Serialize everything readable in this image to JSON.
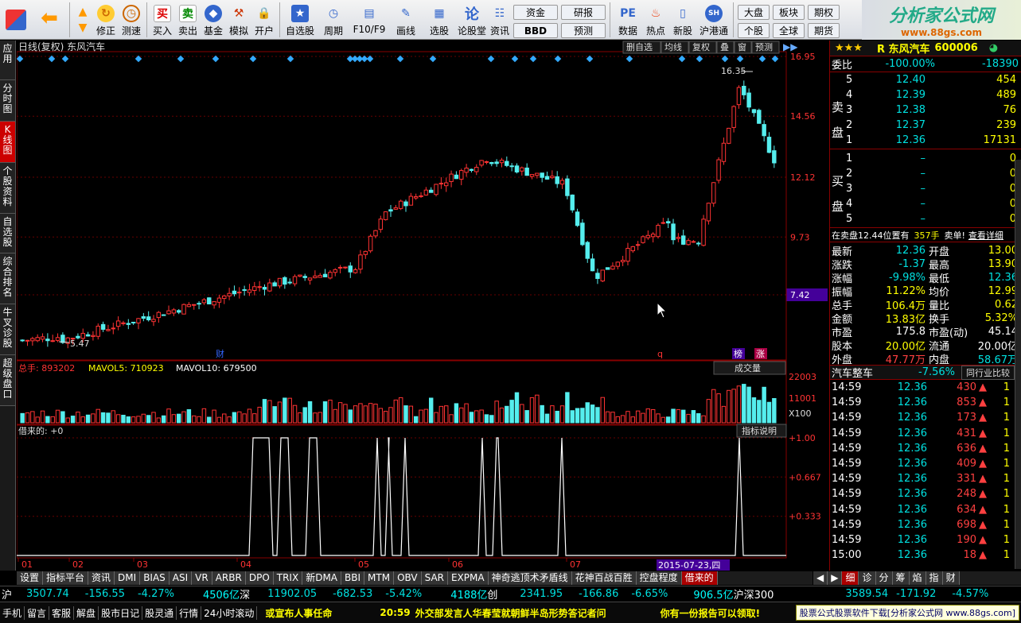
{
  "toolbar": {
    "buttons": [
      "修正",
      "测速",
      "买入",
      "卖出",
      "基金",
      "模拟",
      "开户",
      "自选股",
      "周期",
      "F10/F9",
      "画线",
      "选股",
      "论股堂",
      "资讯",
      "数据",
      "热点",
      "新股",
      "沪港通"
    ],
    "small": [
      "资金",
      "研报",
      "BBD",
      "预测",
      "大盘",
      "板块",
      "期权",
      "个股",
      "全球",
      "期货"
    ]
  },
  "logo": {
    "title": "分析家公式网",
    "url": "www.88gs.com"
  },
  "left_tabs": [
    "应用",
    "分时图",
    "K线图",
    "个股资料",
    "自选股",
    "综合排名",
    "牛叉诊股",
    "超级盘口"
  ],
  "chart_header": {
    "title": "日线(复权) 东风汽车",
    "tabs": [
      "删自选",
      "均线",
      "复权",
      "叠",
      "窗",
      "预测"
    ]
  },
  "price_axis": [
    "16.95",
    "14.56",
    "12.12",
    "9.73",
    "7.42"
  ],
  "annotations": {
    "high": "16.35",
    "low": "5.47",
    "marks": [
      "财",
      "q",
      "榜",
      "涨"
    ]
  },
  "volume_header": {
    "label": "总手: 893202",
    "ma5": "MAVOL5: 710923",
    "ma10": "MAVOL10: 679500",
    "selector": "成交量"
  },
  "volume_axis": [
    "22003",
    "11001",
    "X100"
  ],
  "indicator_header": {
    "label": "借来的: +0",
    "explain": "指标说明"
  },
  "indicator_axis": [
    "+1.00",
    "+0.667",
    "+0.333"
  ],
  "time_axis": [
    "01",
    "02",
    "03",
    "04",
    "05",
    "06",
    "07",
    "2015-07-23,四"
  ],
  "bottom_tabs": [
    "设置",
    "指标平台",
    "资讯",
    "DMI",
    "BIAS",
    "ASI",
    "VR",
    "ARBR",
    "DPO",
    "TRIX",
    "新DMA",
    "BBI",
    "MTM",
    "OBV",
    "SAR",
    "EXPMA",
    "神奇逃顶术矛盾线",
    "花神百战百胜",
    "控盘程度",
    "借来的"
  ],
  "right_bottom_tabs": [
    "细",
    "诊",
    "分",
    "筹",
    "焰",
    "指",
    "财"
  ],
  "stock": {
    "name": "R 东风汽车",
    "code": "600006",
    "weibi_label": "委比",
    "weibi": "-100.00%",
    "weicha": "-18390"
  },
  "sell_levels": [
    {
      "n": "5",
      "price": "12.40",
      "vol": "454"
    },
    {
      "n": "4",
      "price": "12.39",
      "vol": "489"
    },
    {
      "n": "3",
      "price": "12.38",
      "vol": "76"
    },
    {
      "n": "2",
      "price": "12.37",
      "vol": "239"
    },
    {
      "n": "1",
      "price": "12.36",
      "vol": "17131"
    }
  ],
  "buy_levels": [
    {
      "n": "1",
      "price": "–",
      "vol": "0"
    },
    {
      "n": "2",
      "price": "–",
      "vol": "0"
    },
    {
      "n": "3",
      "price": "–",
      "vol": "0"
    },
    {
      "n": "4",
      "price": "–",
      "vol": "0"
    },
    {
      "n": "5",
      "price": "–",
      "vol": "0"
    }
  ],
  "sell_label": "卖盘",
  "buy_label": "买盘",
  "pending": {
    "text": "在卖盘12.44位置有",
    "vol": "357手",
    "sell": "卖单!",
    "detail": "查看详细"
  },
  "quote": [
    {
      "k1": "最新",
      "v1": "12.36",
      "k2": "开盘",
      "v2": "13.00"
    },
    {
      "k1": "涨跌",
      "v1": "-1.37",
      "k2": "最高",
      "v2": "13.90"
    },
    {
      "k1": "涨幅",
      "v1": "-9.98%",
      "k2": "最低",
      "v2": "12.36"
    },
    {
      "k1": "振幅",
      "v1": "11.22%",
      "k2": "均价",
      "v2": "12.99"
    },
    {
      "k1": "总手",
      "v1": "106.4万",
      "k2": "量比",
      "v2": "0.62"
    },
    {
      "k1": "金额",
      "v1": "13.83亿",
      "k2": "换手",
      "v2": "5.32%"
    },
    {
      "k1": "市盈",
      "v1": "175.8",
      "k2": "市盈(动)",
      "v2": "45.14"
    },
    {
      "k1": "股本",
      "v1": "20.00亿",
      "k2": "流通",
      "v2": "20.00亿"
    },
    {
      "k1": "外盘",
      "v1": "47.77万",
      "k2": "内盘",
      "v2": "58.67万"
    }
  ],
  "industry": {
    "name": "汽车整车",
    "change": "-7.56%",
    "compare": "同行业比较"
  },
  "ticks": [
    {
      "t": "14:59",
      "p": "12.36",
      "v": "430",
      "n": "1"
    },
    {
      "t": "14:59",
      "p": "12.36",
      "v": "853",
      "n": "1"
    },
    {
      "t": "14:59",
      "p": "12.36",
      "v": "173",
      "n": "1"
    },
    {
      "t": "14:59",
      "p": "12.36",
      "v": "431",
      "n": "1"
    },
    {
      "t": "14:59",
      "p": "12.36",
      "v": "636",
      "n": "1"
    },
    {
      "t": "14:59",
      "p": "12.36",
      "v": "409",
      "n": "1"
    },
    {
      "t": "14:59",
      "p": "12.36",
      "v": "331",
      "n": "1"
    },
    {
      "t": "14:59",
      "p": "12.36",
      "v": "248",
      "n": "1"
    },
    {
      "t": "14:59",
      "p": "12.36",
      "v": "634",
      "n": "1"
    },
    {
      "t": "14:59",
      "p": "12.36",
      "v": "698",
      "n": "1"
    },
    {
      "t": "14:59",
      "p": "12.36",
      "v": "190",
      "n": "1"
    },
    {
      "t": "15:00",
      "p": "12.36",
      "v": "18",
      "n": "1"
    }
  ],
  "status1": {
    "sh": "沪",
    "sh_val": "3507.74",
    "sh_chg": "-156.55",
    "sh_pct": "-4.27%",
    "sh_amt": "4506亿",
    "sz": "深",
    "sz_val": "11902.05",
    "sz_chg": "-682.53",
    "sz_pct": "-5.42%",
    "sz_amt": "4188亿",
    "cy": "创",
    "cy_val": "2341.95",
    "cy_chg": "-166.86",
    "cy_pct": "-6.65%",
    "cy_amt": "906.5亿",
    "hs": "沪深300",
    "hs_val": "3589.54",
    "hs_chg": "-171.92",
    "hs_pct": "-4.57%"
  },
  "status2": {
    "items": [
      "手机",
      "留言",
      "客服",
      "解盘",
      "股市日记",
      "股灵通",
      "行情",
      "24小时滚动"
    ],
    "news1": "或宣布人事任命",
    "time": "20:59",
    "news2": "外交部发言人华春莹就朝鲜半岛形势答记者问",
    "news3": "你有一份报告可以领取!",
    "ad": "股票公式股票软件下载[分析家公式网 www.88gs.com]"
  }
}
